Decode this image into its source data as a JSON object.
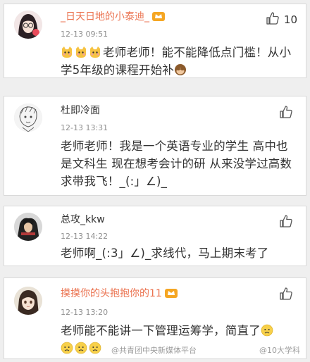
{
  "comments": [
    {
      "name": "_日天日地的小泰迪_",
      "time": "12-13 09:51",
      "likes": "10",
      "text": "老师老师！能不能降低点门槛！从小学5年级的课程开始补",
      "avatar_icon": "girl-glasses-avatar",
      "badge_icon": "member-crown-icon",
      "emoji_prefix": [
        "cat-emoji",
        "cat-emoji",
        "cat-emoji"
      ],
      "emoji_suffix": [
        "monkey-emoji"
      ]
    },
    {
      "name": "杜即冷面",
      "time": "12-13 13:31",
      "likes": "",
      "text": "老师老师！我是一个英语专业的学生 高中也是文科生 现在想考会计的研 从来没学过高数 求带我飞！_(:」∠)_",
      "avatar_icon": "sketch-portrait-avatar"
    },
    {
      "name": "总攻_kkw",
      "time": "12-13 14:22",
      "likes": "",
      "text": "老师啊_(:3」∠)_求线代，马上期末考了",
      "avatar_icon": "dark-character-avatar"
    },
    {
      "name": "摸摸你的头抱抱你的11",
      "time": "12-13 13:20",
      "likes": "",
      "text": "老师能不能讲一下管理运筹学，简直了",
      "avatar_icon": "anime-girl-avatar",
      "badge_icon": "member-crown-icon",
      "emoji_suffix": [
        "sad-face-emoji"
      ],
      "emoji_line2": [
        "sad-face-emoji",
        "sad-face-emoji",
        "sad-face-emoji"
      ]
    }
  ],
  "watermarks": {
    "left": "@共青团中央新媒体平台",
    "right": "@10大学科"
  },
  "colors": {
    "name_highlight": "#eb7350",
    "text": "#333333",
    "time": "#8f8f8f",
    "background": "#efefef"
  }
}
